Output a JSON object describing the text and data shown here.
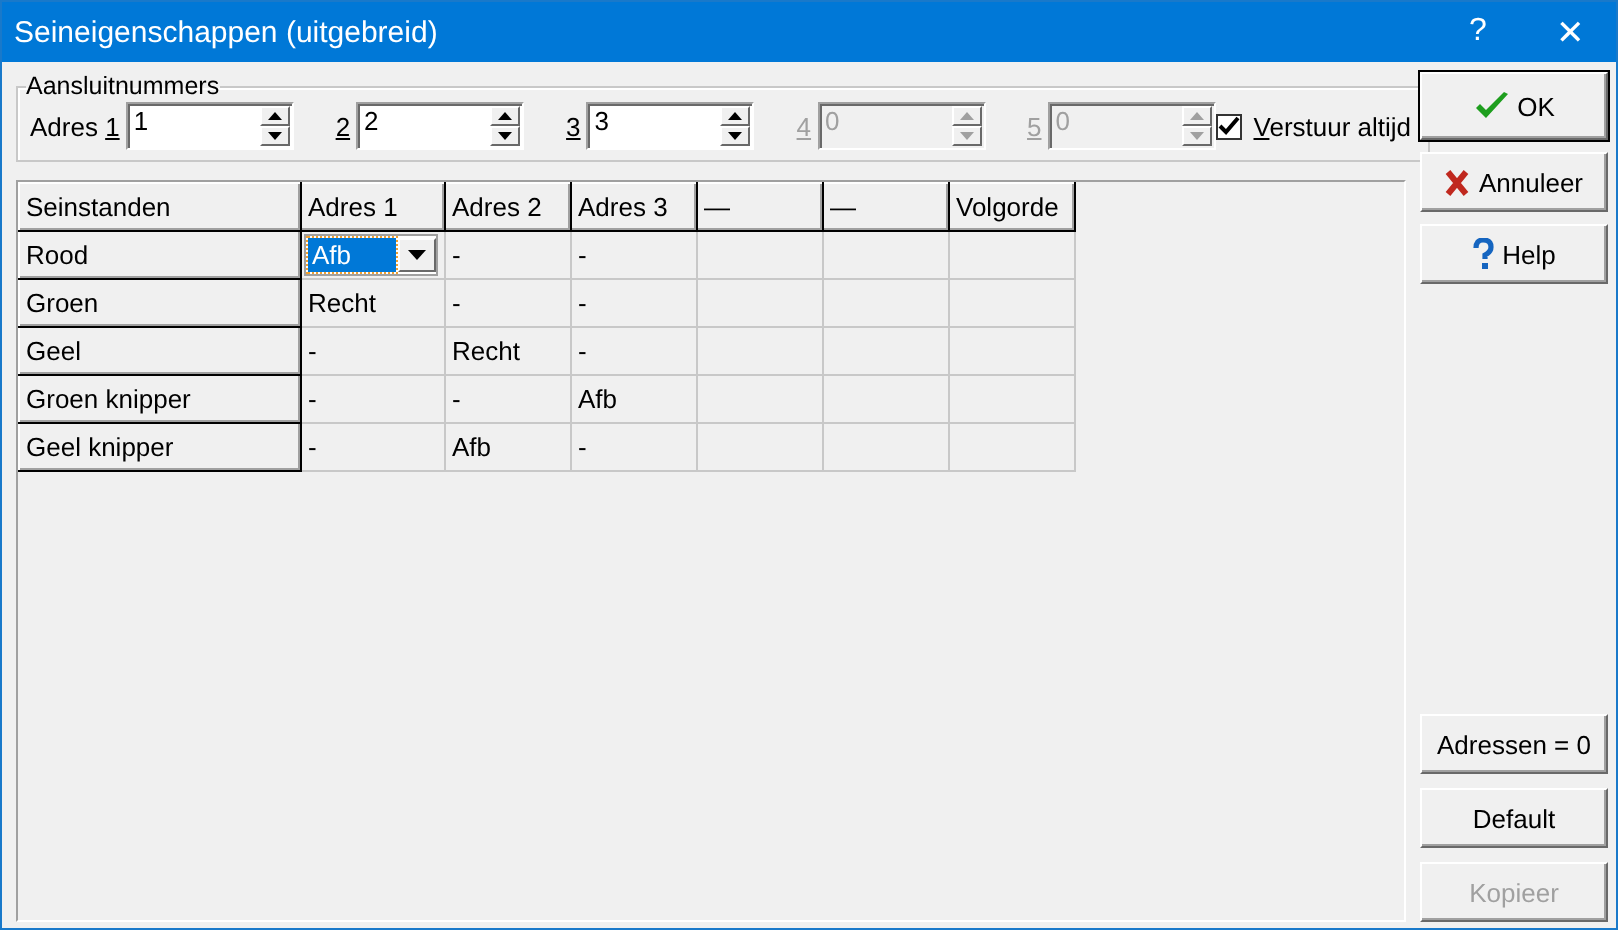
{
  "window": {
    "title": "Seineigenschappen (uitgebreid)",
    "help_glyph": "?",
    "close_glyph": "✕"
  },
  "group": {
    "title": "Aansluitnummers",
    "fields": [
      {
        "prefix": "Adres ",
        "key": "1",
        "value": "1",
        "disabled": false
      },
      {
        "key": "2",
        "value": "2",
        "disabled": false
      },
      {
        "key": "3",
        "value": "3",
        "disabled": false
      },
      {
        "key": "4",
        "value": "0",
        "disabled": true
      },
      {
        "key": "5",
        "value": "0",
        "disabled": true
      }
    ],
    "checkbox": {
      "key": "V",
      "rest": "erstuur altijd",
      "checked": true
    }
  },
  "table": {
    "columns": [
      "Seinstanden",
      "Adres 1",
      "Adres 2",
      "Adres 3",
      "—",
      "—",
      "Volgorde"
    ],
    "rows": [
      {
        "cells": [
          {
            "kind": "row_header",
            "value": "Rood"
          },
          {
            "kind": "dropdown",
            "value": "Afb"
          },
          {
            "kind": "text",
            "value": "-"
          },
          {
            "kind": "text",
            "value": "-"
          }
        ]
      },
      {
        "cells": [
          {
            "kind": "row_header",
            "value": "Groen"
          },
          {
            "kind": "text",
            "value": "Recht"
          },
          {
            "kind": "text",
            "value": "-"
          },
          {
            "kind": "text",
            "value": "-"
          }
        ]
      },
      {
        "cells": [
          {
            "kind": "row_header",
            "value": "Geel"
          },
          {
            "kind": "text",
            "value": "-"
          },
          {
            "kind": "text",
            "value": "Recht"
          },
          {
            "kind": "text",
            "value": "-"
          }
        ]
      },
      {
        "cells": [
          {
            "kind": "row_header",
            "value": "Groen knipper"
          },
          {
            "kind": "text",
            "value": "-"
          },
          {
            "kind": "text",
            "value": "-"
          },
          {
            "kind": "text",
            "value": "Afb"
          }
        ]
      },
      {
        "cells": [
          {
            "kind": "row_header",
            "value": "Geel knipper"
          },
          {
            "kind": "text",
            "value": "-"
          },
          {
            "kind": "text",
            "value": "Afb"
          },
          {
            "kind": "text",
            "value": "-"
          }
        ]
      }
    ]
  },
  "buttons_top": [
    {
      "kind": "ok",
      "label": "OK",
      "disabled": false
    },
    {
      "kind": "cancel",
      "label": "Annuleer",
      "disabled": false
    },
    {
      "kind": "help",
      "label": "Help",
      "disabled": false
    }
  ],
  "buttons_bottom": [
    {
      "label": "Adressen = 0",
      "disabled": false
    },
    {
      "label": "Default",
      "disabled": false
    },
    {
      "label": "Kopieer",
      "disabled": true
    }
  ]
}
